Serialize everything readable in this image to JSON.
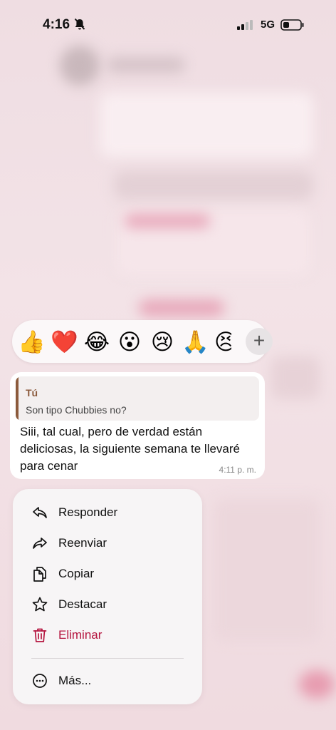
{
  "status_bar": {
    "time": "4:16",
    "network": "5G"
  },
  "reactions": {
    "emojis": [
      "👍",
      "❤️",
      "😂",
      "😮",
      "😢",
      "🙏",
      "😣"
    ],
    "more_label": "+"
  },
  "message": {
    "quote_author": "Tú",
    "quote_text": "Son tipo Chubbies no?",
    "text": "Siii, tal cual, pero de verdad están deliciosas, la siguiente semana te llevaré para cenar",
    "time": "4:11 p. m."
  },
  "menu": {
    "items": [
      {
        "label": "Responder",
        "icon": "reply-icon"
      },
      {
        "label": "Reenviar",
        "icon": "forward-icon"
      },
      {
        "label": "Copiar",
        "icon": "copy-icon"
      },
      {
        "label": "Destacar",
        "icon": "star-icon"
      },
      {
        "label": "Eliminar",
        "icon": "trash-icon"
      },
      {
        "label": "Más...",
        "icon": "more-icon"
      }
    ],
    "danger_color": "#b5153f"
  }
}
